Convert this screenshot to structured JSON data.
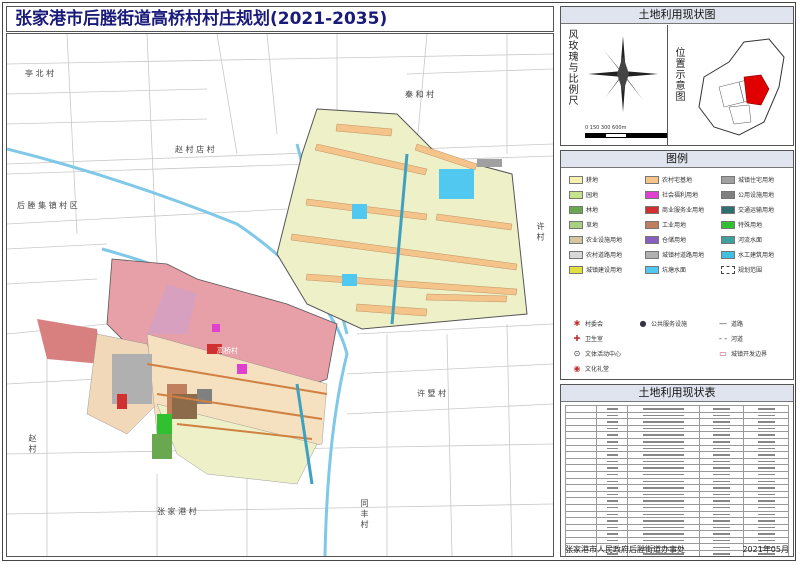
{
  "title": "张家港市后塍街道高桥村村庄规划(2021-2035)",
  "map": {
    "labels": {
      "top_left": "亭 北 村",
      "top_middle_top": "秦 和 村",
      "top_center": "赵 村 店 村",
      "left": "后 塍 集 镇 村 区",
      "right_middle": "许 村",
      "right_lower": "许 墅 村",
      "bottom_left": "赵 村",
      "bottom_middle": "张 家 港 村",
      "bottom_right": "同 丰 村",
      "village_center": "高桥村"
    }
  },
  "sidebar": {
    "figure_title": "土地利用现状图",
    "compass_label": "风玫瑰与比例尺",
    "location_label": "位置示意图",
    "scale_text": "0 150 300 600m",
    "legend_title": "图例",
    "legend": [
      {
        "label": "耕地",
        "color": "#f5f0b0"
      },
      {
        "label": "农村宅基地",
        "color": "#f5c48a"
      },
      {
        "label": "城镇住宅用地",
        "color": "#a0a0a0"
      },
      {
        "label": "园地",
        "color": "#c4e38a"
      },
      {
        "label": "社会福利用地",
        "color": "#e040d0"
      },
      {
        "label": "公用设施用地",
        "color": "#808080"
      },
      {
        "label": "林地",
        "color": "#6aa84f"
      },
      {
        "label": "商业服务业用地",
        "color": "#d03030"
      },
      {
        "label": "交通运输用地",
        "color": "#2f6f6f"
      },
      {
        "label": "草地",
        "color": "#a8d080"
      },
      {
        "label": "工业用地",
        "color": "#c08060"
      },
      {
        "label": "特殊用地",
        "color": "#30c030"
      },
      {
        "label": "农业设施用地",
        "color": "#d4c8a0"
      },
      {
        "label": "仓储用地",
        "color": "#8860c0"
      },
      {
        "label": "河流水面",
        "color": "#40a0a0"
      },
      {
        "label": "农村道路用地",
        "color": "#d8d8d8"
      },
      {
        "label": "城镇村道路用地",
        "color": "#b0b0b0"
      },
      {
        "label": "水工建筑用地",
        "color": "#40c0e0"
      },
      {
        "label": "城镇建设用地",
        "color": "#e0e040"
      },
      {
        "label": "坑塘水面",
        "color": "#50c8f0"
      },
      {
        "label": "规划范围",
        "color": "#ffffff"
      }
    ],
    "symbols": [
      {
        "label": "村委会"
      },
      {
        "label": "公共服务设施"
      },
      {
        "label": "道路"
      },
      {
        "label": "卫生室"
      },
      {
        "label": "河道"
      },
      {
        "label": "文体活动中心"
      },
      {
        "label": "城镇开发边界"
      },
      {
        "label": "文化礼堂"
      }
    ],
    "table_title": "土地利用现状表",
    "footer_left": "张家港市人民政府后塍街道办事处",
    "footer_right": "2021年05月"
  }
}
